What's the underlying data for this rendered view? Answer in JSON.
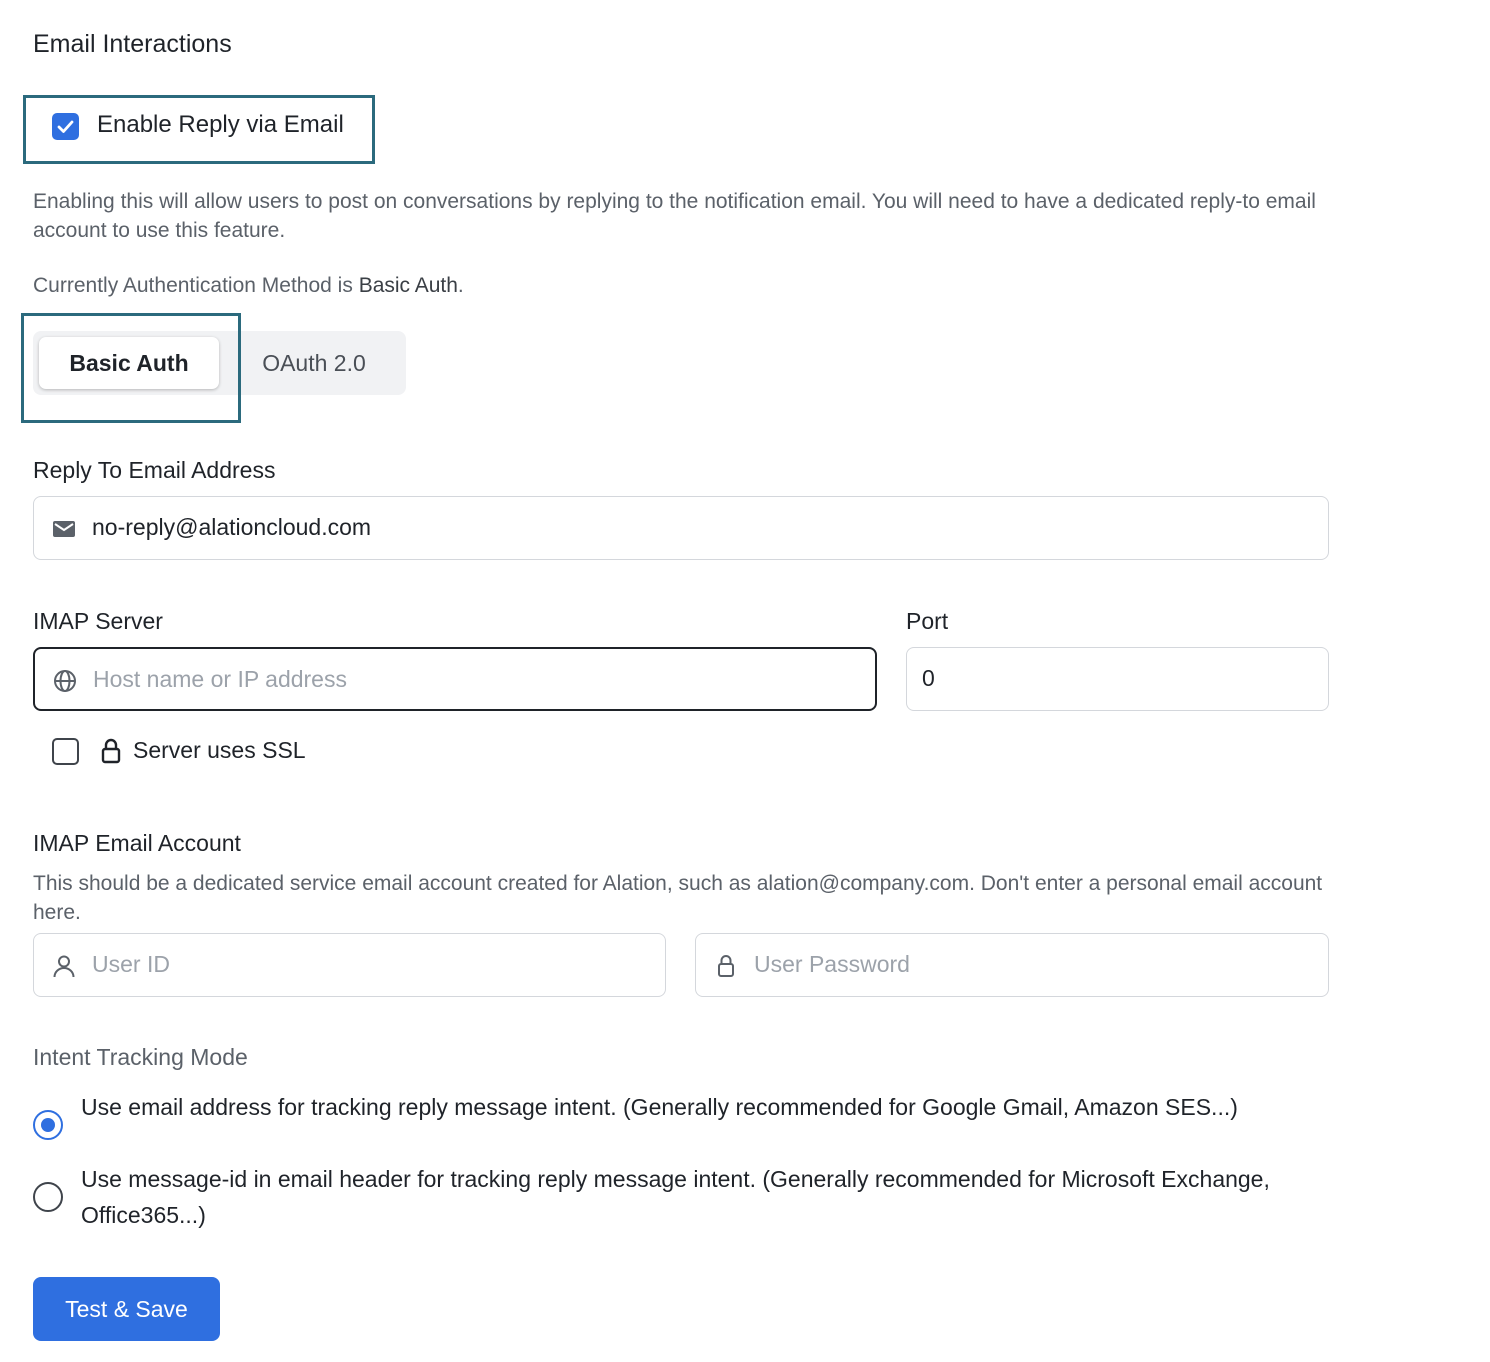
{
  "section": {
    "title": "Email Interactions"
  },
  "enable_reply": {
    "label": "Enable Reply via Email",
    "checked": true
  },
  "help_text": "Enabling this will allow users to post on conversations by replying to the notification email. You will need to have a dedicated reply-to email account to use this feature.",
  "auth": {
    "current_prefix": "Currently Authentication Method is ",
    "current_method": "Basic Auth",
    "current_suffix": ".",
    "tabs": [
      {
        "label": "Basic Auth",
        "selected": true
      },
      {
        "label": "OAuth 2.0",
        "selected": false
      }
    ]
  },
  "reply_to": {
    "label": "Reply To Email Address",
    "value": "no-reply@alationcloud.com",
    "icon": "mail-icon"
  },
  "imap_server": {
    "label": "IMAP Server",
    "placeholder": "Host name or IP address",
    "icon": "globe-icon"
  },
  "port": {
    "label": "Port",
    "value": "0"
  },
  "ssl": {
    "label": "Server uses SSL",
    "checked": false,
    "icon": "lock-icon"
  },
  "imap_account": {
    "label": "IMAP Email Account",
    "help": "This should be a dedicated service email account created for Alation, such as alation@company.com. Don't enter a personal email account here.",
    "user_id_placeholder": "User ID",
    "password_placeholder": "User Password"
  },
  "intent": {
    "title": "Intent Tracking Mode",
    "options": [
      {
        "label": "Use email address for tracking reply message intent. (Generally recommended for Google Gmail, Amazon SES...)",
        "selected": true
      },
      {
        "label": "Use message-id in email header for tracking reply message intent. (Generally recommended for Microsoft Exchange, Office365...)",
        "selected": false
      }
    ]
  },
  "actions": {
    "save_label": "Test & Save"
  },
  "colors": {
    "accent": "#2f6fe0",
    "highlight_border": "#2b6a7d"
  }
}
